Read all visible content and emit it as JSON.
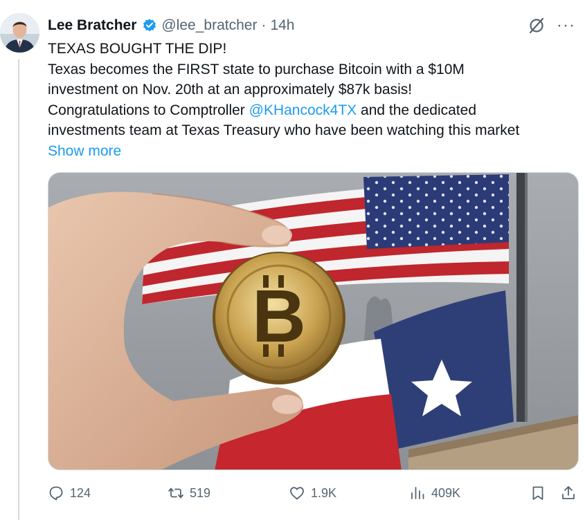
{
  "author": {
    "display_name": "Lee Bratcher",
    "handle": "@lee_bratcher",
    "separator": "·",
    "time": "14h",
    "verified_color": "#1d9bf0"
  },
  "tweet": {
    "lines": [
      "TEXAS BOUGHT THE DIP!",
      "Texas becomes the FIRST state to purchase Bitcoin with a $10M",
      "investment on Nov. 20th at an approximately $87k basis!"
    ],
    "line4_prefix": "Congratulations to Comptroller ",
    "mention": "@KHancock4TX",
    "line4_suffix": " and the dedicated",
    "line5": "investments team at Texas Treasury who have been watching this market",
    "show_more": "Show more"
  },
  "media": {
    "description_icon": "image-icon"
  },
  "actions": {
    "replies": "124",
    "reposts": "519",
    "likes": "1.9K",
    "views": "409K"
  },
  "colors": {
    "accent": "#1d9bf0",
    "muted": "#536471",
    "text": "#0f1419"
  }
}
